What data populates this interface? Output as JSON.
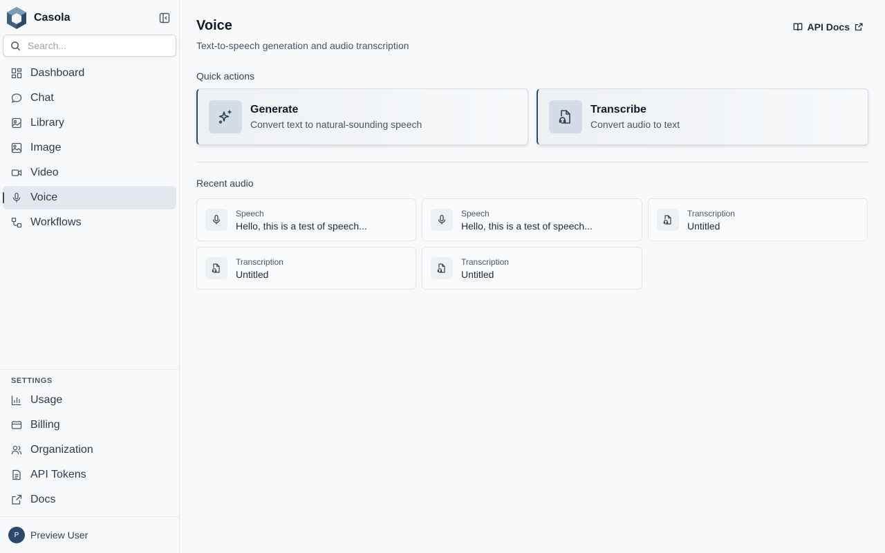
{
  "brand": {
    "name": "Casola",
    "logo": "hexagon-logo-icon",
    "collapse_icon": "sidebar-collapse-icon"
  },
  "search": {
    "placeholder": "Search...",
    "value": ""
  },
  "nav": {
    "items": [
      {
        "label": "Dashboard",
        "icon": "dashboard-icon",
        "active": false
      },
      {
        "label": "Chat",
        "icon": "chat-icon",
        "active": false
      },
      {
        "label": "Library",
        "icon": "library-icon",
        "active": false
      },
      {
        "label": "Image",
        "icon": "image-icon",
        "active": false
      },
      {
        "label": "Video",
        "icon": "video-icon",
        "active": false
      },
      {
        "label": "Voice",
        "icon": "mic-icon",
        "active": true
      },
      {
        "label": "Workflows",
        "icon": "workflow-icon",
        "active": false
      }
    ]
  },
  "settings": {
    "heading": "SETTINGS",
    "items": [
      {
        "label": "Usage",
        "icon": "bar-chart-icon"
      },
      {
        "label": "Billing",
        "icon": "credit-card-icon"
      },
      {
        "label": "Organization",
        "icon": "users-icon"
      },
      {
        "label": "API Tokens",
        "icon": "file-text-icon"
      },
      {
        "label": "Docs",
        "icon": "external-link-icon"
      }
    ]
  },
  "user": {
    "initial": "P",
    "name": "Preview User"
  },
  "page": {
    "title": "Voice",
    "subtitle": "Text-to-speech generation and audio transcription",
    "api_docs": "API Docs"
  },
  "quick_actions": {
    "heading": "Quick actions",
    "items": [
      {
        "title": "Generate",
        "description": "Convert text to natural-sounding speech",
        "icon": "sparkles-icon"
      },
      {
        "title": "Transcribe",
        "description": "Convert audio to text",
        "icon": "audio-file-icon"
      }
    ]
  },
  "recent": {
    "heading": "Recent audio",
    "items": [
      {
        "type": "Speech",
        "title": "Hello, this is a test of speech...",
        "icon": "mic-icon"
      },
      {
        "type": "Speech",
        "title": "Hello, this is a test of speech...",
        "icon": "mic-icon"
      },
      {
        "type": "Transcription",
        "title": "Untitled",
        "icon": "audio-file-icon"
      },
      {
        "type": "Transcription",
        "title": "Untitled",
        "icon": "audio-file-icon"
      },
      {
        "type": "Transcription",
        "title": "Untitled",
        "icon": "audio-file-icon"
      }
    ]
  },
  "colors": {
    "accent": "#2c4a6b",
    "active_bg": "#e3e8ee",
    "background": "#f7f9fb"
  }
}
